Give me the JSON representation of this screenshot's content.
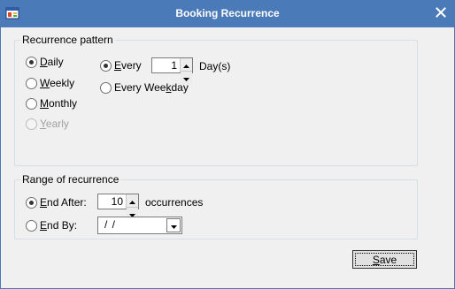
{
  "window": {
    "title": "Booking Recurrence",
    "close_icon": "close-icon",
    "app_icon": "app-window-icon",
    "colors": {
      "titlebar": "#4b7ab8",
      "client": "#f0f0f0"
    }
  },
  "pattern": {
    "legend": "Recurrence pattern",
    "frequency": [
      {
        "prefix": "",
        "underline": "D",
        "rest": "aily",
        "checked": true,
        "enabled": true
      },
      {
        "prefix": "",
        "underline": "W",
        "rest": "eekly",
        "checked": false,
        "enabled": true
      },
      {
        "prefix": "",
        "underline": "M",
        "rest": "onthly",
        "checked": false,
        "enabled": true
      },
      {
        "prefix": "",
        "underline": "Y",
        "rest": "early",
        "checked": false,
        "enabled": false
      }
    ],
    "every": {
      "prefix": "",
      "underline": "E",
      "rest": "very",
      "checked": true
    },
    "every_value": "1",
    "days_label": "Day(s)",
    "weekday": {
      "prefix": "Every Wee",
      "underline": "k",
      "rest": "day",
      "checked": false
    }
  },
  "range": {
    "legend": "Range of recurrence",
    "end_after": {
      "prefix": "",
      "underline": "E",
      "rest": "nd After:",
      "checked": true
    },
    "end_after_value": "10",
    "occurrences_label": "occurrences",
    "end_by": {
      "prefix": "",
      "underline": "E",
      "rest": "nd By:",
      "checked": false
    },
    "end_by_value": "/  /"
  },
  "footer": {
    "save": {
      "prefix": "",
      "underline": "S",
      "rest": "ave"
    }
  }
}
